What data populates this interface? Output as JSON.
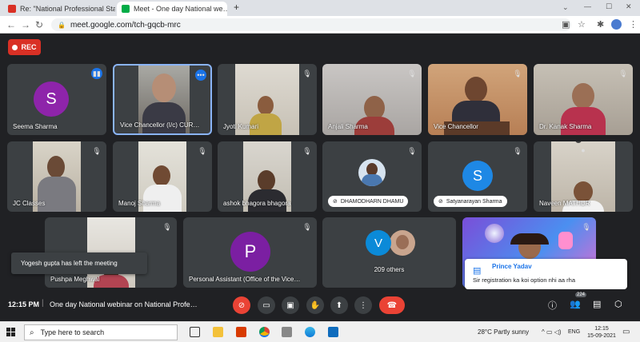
{
  "browser": {
    "tabs": [
      {
        "label": "Re: \"National Professional Standa…",
        "favicon_color": "#d93025"
      },
      {
        "label": "Meet - One day National we…",
        "favicon_color": "#00ac47"
      }
    ],
    "new_tab": "+",
    "url": "meet.google.com/tch-gqcb-mrc"
  },
  "meet": {
    "rec_label": "REC",
    "tiles": [
      {
        "name": "Seema Sharma",
        "avatar": "S",
        "avatar_color": "#8e24aa"
      },
      {
        "name": "Vice Chancellor (I/c) CUR…",
        "video": true
      },
      {
        "name": "Jyoti Kumari",
        "video": true
      },
      {
        "name": "Anjali Sharma",
        "video": true
      },
      {
        "name": "Vice Chancellor",
        "video": true
      },
      {
        "name": "Dr. Kanak Sharma",
        "video": true
      },
      {
        "name": "JC Classes",
        "video": true
      },
      {
        "name": "Manoj Sharma",
        "video": true
      },
      {
        "name": "ashok bhagora bhagora",
        "video": true
      },
      {
        "name": "DHAMODHARN DHAMU",
        "video": false
      },
      {
        "name": "Satyanarayan Sharma",
        "avatar": "S",
        "avatar_color": "#1e88e5"
      },
      {
        "name": "Naveen MATHUR",
        "video": true
      },
      {
        "name": "Pushpa Meghwal",
        "video": true
      },
      {
        "name": "Personal Assistant (Office of the Vice…",
        "avatar": "P",
        "avatar_color": "#7b1fa2"
      },
      {
        "name": "209 others",
        "avatar": "V",
        "avatar_color": "#0b8ad8"
      },
      {
        "name": "",
        "video": true
      }
    ],
    "toast": "Yogesh gupta has left the meeting",
    "chat": {
      "sender": "Prince Yadav",
      "message": "Sir registration ka koi option nhi aa rha"
    }
  },
  "bottombar": {
    "time": "12:15 PM",
    "separator": "|",
    "title": "One day National webinar on National Profe…",
    "participants_count": "224"
  },
  "taskbar": {
    "search_placeholder": "Type here to search",
    "weather": "28°C  Partly sunny",
    "lang": "ENG",
    "time": "12:15",
    "date": "15-09-2021"
  }
}
